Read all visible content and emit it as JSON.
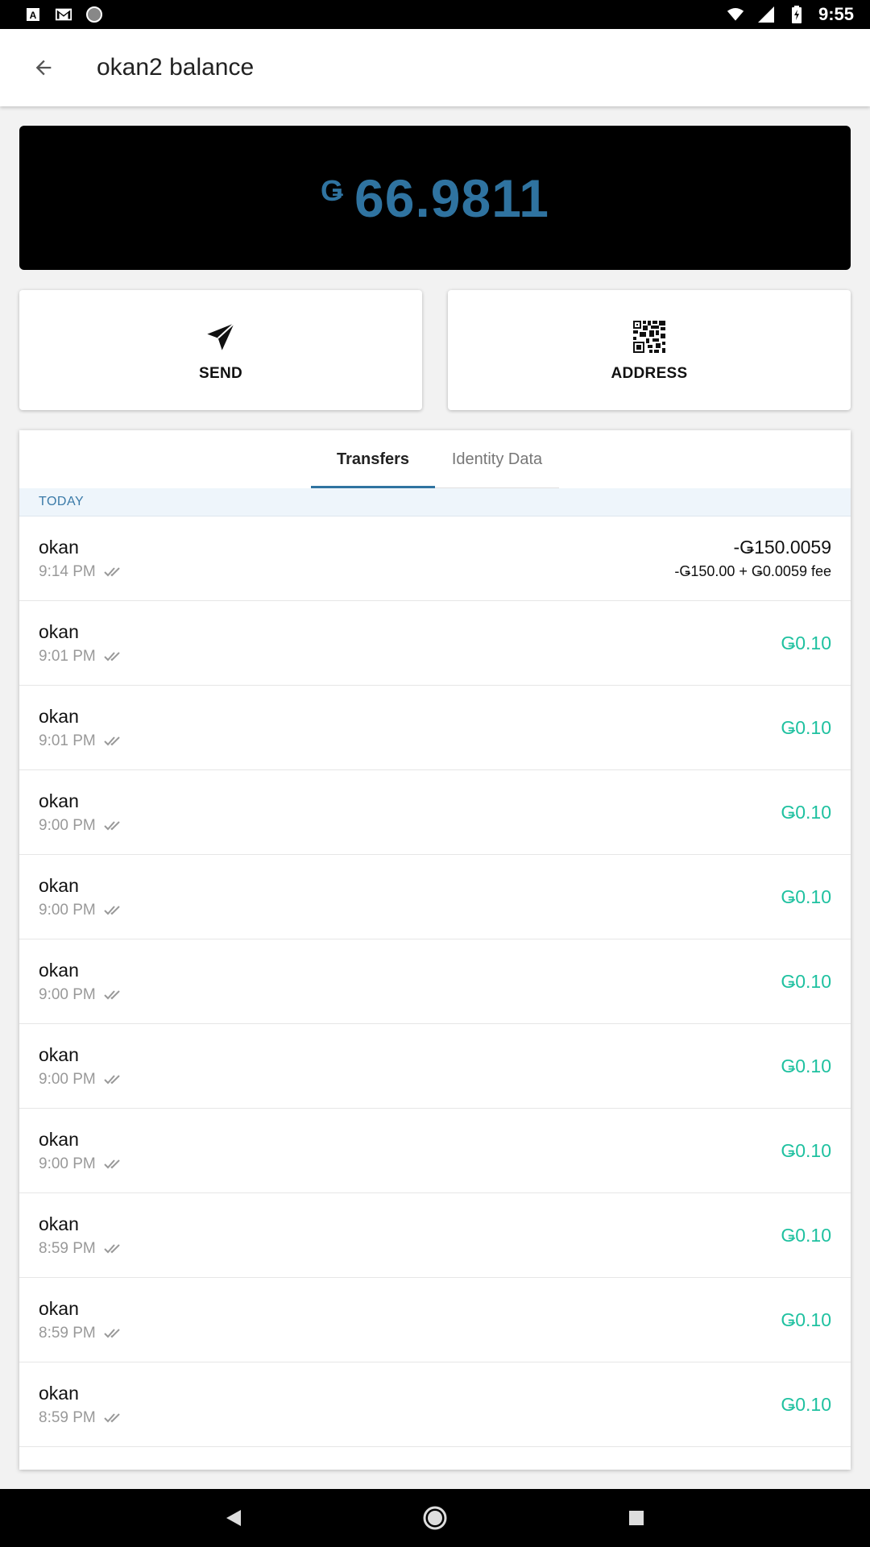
{
  "status_bar": {
    "time": "9:55",
    "icons_left": [
      "font-icon",
      "gmail-icon",
      "circle-icon"
    ],
    "icons_right": [
      "wifi-icon",
      "signal-icon",
      "battery-icon"
    ]
  },
  "app_bar": {
    "title": "okan2 balance",
    "back_icon": "arrow-back-icon"
  },
  "balance": {
    "symbol": "Ǥ",
    "value": "66.9811",
    "color": "#2f73a0"
  },
  "actions": {
    "send_label": "SEND",
    "send_icon": "paper-plane-icon",
    "address_label": "ADDRESS",
    "address_icon": "qr-code-icon"
  },
  "tabs": [
    {
      "label": "Transfers",
      "active": true
    },
    {
      "label": "Identity Data",
      "active": false
    }
  ],
  "section": {
    "label": "TODAY"
  },
  "transactions": [
    {
      "name": "okan",
      "time": "9:14 PM",
      "amount": "-Ǥ150.0059",
      "detail": "-Ǥ150.00 + Ǥ0.0059 fee",
      "type": "out"
    },
    {
      "name": "okan",
      "time": "9:01 PM",
      "amount": "Ǥ0.10",
      "type": "in"
    },
    {
      "name": "okan",
      "time": "9:01 PM",
      "amount": "Ǥ0.10",
      "type": "in"
    },
    {
      "name": "okan",
      "time": "9:00 PM",
      "amount": "Ǥ0.10",
      "type": "in"
    },
    {
      "name": "okan",
      "time": "9:00 PM",
      "amount": "Ǥ0.10",
      "type": "in"
    },
    {
      "name": "okan",
      "time": "9:00 PM",
      "amount": "Ǥ0.10",
      "type": "in"
    },
    {
      "name": "okan",
      "time": "9:00 PM",
      "amount": "Ǥ0.10",
      "type": "in"
    },
    {
      "name": "okan",
      "time": "9:00 PM",
      "amount": "Ǥ0.10",
      "type": "in"
    },
    {
      "name": "okan",
      "time": "8:59 PM",
      "amount": "Ǥ0.10",
      "type": "in"
    },
    {
      "name": "okan",
      "time": "8:59 PM",
      "amount": "Ǥ0.10",
      "type": "in"
    },
    {
      "name": "okan",
      "time": "8:59 PM",
      "amount": "Ǥ0.10",
      "type": "in"
    }
  ],
  "colors": {
    "accent": "#2f73a0",
    "positive": "#1fc1a0",
    "section_bg": "#eef5fb"
  },
  "nav": {
    "back": "nav-back-icon",
    "home": "nav-home-icon",
    "recents": "nav-recents-icon"
  }
}
